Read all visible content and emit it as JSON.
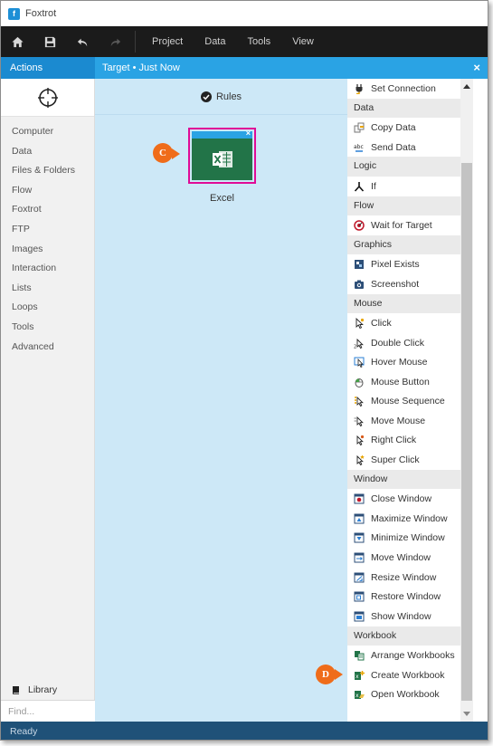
{
  "app": {
    "title": "Foxtrot"
  },
  "toolbar": {
    "menus": [
      "Project",
      "Data",
      "Tools",
      "View"
    ]
  },
  "actions_panel": {
    "title": "Actions"
  },
  "target_bar": {
    "label": "Target  •  Just Now",
    "close_glyph": "×"
  },
  "sidebar": {
    "categories": [
      "Computer",
      "Data",
      "Files & Folders",
      "Flow",
      "Foxtrot",
      "FTP",
      "Images",
      "Interaction",
      "Lists",
      "Loops",
      "Tools",
      "Advanced"
    ],
    "library_label": "Library",
    "find_placeholder": "Find..."
  },
  "canvas": {
    "rules_label": "Rules",
    "tile_close": "×",
    "tile_label": "Excel"
  },
  "callouts": {
    "c": "C",
    "d": "D"
  },
  "palette": {
    "top_item": "Set Connection",
    "groups": [
      {
        "name": "Data",
        "items": [
          "Copy Data",
          "Send Data"
        ]
      },
      {
        "name": "Logic",
        "items": [
          "If"
        ]
      },
      {
        "name": "Flow",
        "items": [
          "Wait for Target"
        ]
      },
      {
        "name": "Graphics",
        "items": [
          "Pixel Exists",
          "Screenshot"
        ]
      },
      {
        "name": "Mouse",
        "items": [
          "Click",
          "Double Click",
          "Hover Mouse",
          "Mouse Button",
          "Mouse Sequence",
          "Move Mouse",
          "Right Click",
          "Super Click"
        ]
      },
      {
        "name": "Window",
        "items": [
          "Close Window",
          "Maximize Window",
          "Minimize Window",
          "Move Window",
          "Resize Window",
          "Restore Window",
          "Show Window"
        ]
      },
      {
        "name": "Workbook",
        "items": [
          "Arrange Workbooks",
          "Create Workbook",
          "Open Workbook"
        ]
      }
    ]
  },
  "status": {
    "text": "Ready"
  },
  "colors": {
    "accent": "#2aa3e4",
    "highlight": "#e00b96",
    "callout": "#ef6c1a",
    "excel": "#227448"
  }
}
